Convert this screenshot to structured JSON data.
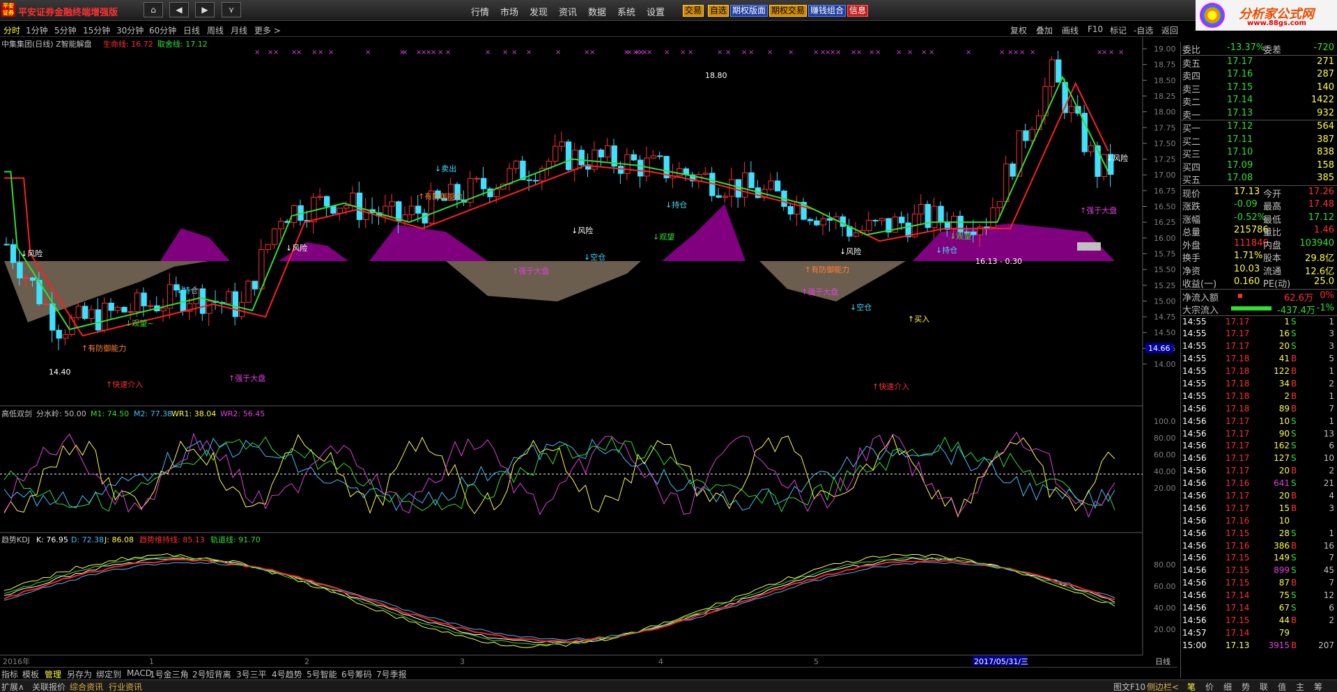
{
  "titlebar": {
    "logo_text": "平安证券",
    "app_title": "平安证券金融终端增强版",
    "menu": [
      "行情",
      "市场",
      "发现",
      "资讯",
      "数据",
      "系统",
      "设置"
    ],
    "buttons": [
      "交易",
      "自选",
      "期权版面",
      "期权交易",
      "赚钱组合",
      "信息"
    ]
  },
  "brand": {
    "name": "分析家公式网",
    "url": "www.88gs.com"
  },
  "periods": [
    "分时",
    "1分钟",
    "5分钟",
    "15分钟",
    "30分钟",
    "60分钟",
    "日线",
    "周线",
    "月线",
    "更多 >"
  ],
  "active_period": "分时",
  "right_tools": [
    "复权",
    "叠加",
    "画线",
    "F10",
    "标记",
    "-自选",
    "返回"
  ],
  "main": {
    "stock": "中集集团(日线) Z智能解盘",
    "line1_label": "生命线: 16.72",
    "line2_label": "取舍线: 17.12",
    "marker": "×",
    "price_tag": "14.66",
    "axis": [
      "19.00",
      "18.75",
      "18.50",
      "18.25",
      "18.00",
      "17.75",
      "17.50",
      "17.25",
      "17.00",
      "16.75",
      "16.50",
      "16.25",
      "16.00",
      "15.75",
      "15.50",
      "15.25",
      "15.00",
      "14.75",
      "14.50",
      "14.25",
      "14.00"
    ],
    "annotations": {
      "risk": "↓风险",
      "sell": "↓卖出",
      "buy": "↑买入",
      "strong": "↑强于大盘",
      "fast": "↑快速介入",
      "defense": "↑有防御能力",
      "wait": "↓观望~",
      "wait2": "↓观望",
      "hold": "↓持仓",
      "empty": "↓空仓",
      "high": "18.80",
      "low": "14.40",
      "range": "16.13 - 0.30"
    }
  },
  "osc": {
    "name": "高低双剑",
    "label": "分水岭: 50.00",
    "m1": "M1: 74.50",
    "m2": "M2: 77.38",
    "wr1": "WR1: 38.04",
    "wr2": "WR2: 56.45",
    "axis": [
      "100.0",
      "80.00",
      "60.00",
      "40.00",
      "20.00"
    ]
  },
  "kdj": {
    "name": "趋势KDJ",
    "k": "K: 76.95",
    "d": "D: 72.38",
    "j": "J: 86.08",
    "trend": "趋势维持线: 85.13",
    "track": "轨道线: 91.70",
    "axis": [
      "80.00",
      "60.00",
      "40.00",
      "20.00"
    ]
  },
  "xaxis": {
    "year": "2016年",
    "months": [
      "1",
      "2",
      "3",
      "4",
      "5"
    ],
    "date": "2017/05/31/三",
    "type": "日线"
  },
  "colors": {
    "up": "#ff3030",
    "down": "#40e0ff",
    "green": "#30e030",
    "red": "#ff2020",
    "purple": "#800080",
    "gray": "#6b5e4e"
  },
  "orderbook": {
    "wei": [
      {
        "label": "委比",
        "value": "-13.37%",
        "label2": "委差",
        "value2": "-720"
      }
    ],
    "sell": [
      {
        "l": "卖五",
        "p": "17.17",
        "v": "271"
      },
      {
        "l": "卖四",
        "p": "17.16",
        "v": "287"
      },
      {
        "l": "卖三",
        "p": "17.15",
        "v": "140"
      },
      {
        "l": "卖二",
        "p": "17.14",
        "v": "1422"
      },
      {
        "l": "卖一",
        "p": "17.13",
        "v": "932"
      }
    ],
    "buy": [
      {
        "l": "买一",
        "p": "17.12",
        "v": "564"
      },
      {
        "l": "买二",
        "p": "17.11",
        "v": "387"
      },
      {
        "l": "买三",
        "p": "17.10",
        "v": "838"
      },
      {
        "l": "买四",
        "p": "17.09",
        "v": "158"
      },
      {
        "l": "买五",
        "p": "17.08",
        "v": "385"
      }
    ],
    "stats": [
      {
        "l1": "现价",
        "v1": "17.13",
        "c1": "#ffff40",
        "l2": "今开",
        "v2": "17.26",
        "c2": "#ff3030"
      },
      {
        "l1": "涨跌",
        "v1": "-0.09",
        "c1": "#30e030",
        "l2": "最高",
        "v2": "17.48",
        "c2": "#ff3030"
      },
      {
        "l1": "涨幅",
        "v1": "-0.52%",
        "c1": "#30e030",
        "l2": "最低",
        "v2": "17.12",
        "c2": "#30e030"
      },
      {
        "l1": "总量",
        "v1": "215786",
        "c1": "#ffff40",
        "l2": "量比",
        "v2": "1.46",
        "c2": "#ff3030"
      },
      {
        "l1": "外盘",
        "v1": "111846",
        "c1": "#ff3030",
        "l2": "内盘",
        "v2": "103940",
        "c2": "#30e030"
      },
      {
        "l1": "换手",
        "v1": "1.71%",
        "c1": "#ffff40",
        "l2": "股本",
        "v2": "29.8亿",
        "c2": "#ffff40"
      },
      {
        "l1": "净资",
        "v1": "10.03",
        "c1": "#ffff40",
        "l2": "流通",
        "v2": "12.6亿",
        "c2": "#ffff40"
      },
      {
        "l1": "收益(一)",
        "v1": "0.160",
        "c1": "#ffff40",
        "l2": "PE(动)",
        "v2": "25.0",
        "c2": "#ffff40"
      }
    ],
    "netflow": {
      "l": "净流入额",
      "v": "62.6万",
      "p": "0%"
    },
    "bigflow": {
      "l": "大宗流入",
      "v": "-437.4万",
      "p": "-1%"
    }
  },
  "ticks": [
    [
      "14:55",
      "17.17",
      "1",
      "S",
      "1"
    ],
    [
      "14:55",
      "17.17",
      "16",
      "S",
      "3"
    ],
    [
      "14:55",
      "17.17",
      "20",
      "S",
      "3"
    ],
    [
      "14:55",
      "17.18",
      "41",
      "B",
      "5"
    ],
    [
      "14:55",
      "17.18",
      "122",
      "B",
      "1"
    ],
    [
      "14:55",
      "17.18",
      "34",
      "B",
      "2"
    ],
    [
      "14:55",
      "17.18",
      "2",
      "B",
      "1"
    ],
    [
      "14:56",
      "17.18",
      "89",
      "B",
      "7"
    ],
    [
      "14:56",
      "17.17",
      "10",
      "S",
      "1"
    ],
    [
      "14:56",
      "17.17",
      "90",
      "S",
      "13"
    ],
    [
      "14:56",
      "17.17",
      "162",
      "S",
      "6"
    ],
    [
      "14:56",
      "17.17",
      "127",
      "S",
      "10"
    ],
    [
      "14:56",
      "17.17",
      "20",
      "B",
      "2"
    ],
    [
      "14:56",
      "17.16",
      "641",
      "S",
      "21"
    ],
    [
      "14:56",
      "17.17",
      "20",
      "B",
      "4"
    ],
    [
      "14:56",
      "17.17",
      "15",
      "B",
      "3"
    ],
    [
      "14:56",
      "17.16",
      "10",
      "",
      ""
    ],
    [
      "14:56",
      "17.15",
      "28",
      "S",
      "1"
    ],
    [
      "14:56",
      "17.16",
      "386",
      "B",
      "16"
    ],
    [
      "14:56",
      "17.15",
      "149",
      "S",
      "7"
    ],
    [
      "14:56",
      "17.15",
      "899",
      "S",
      "45"
    ],
    [
      "14:56",
      "17.15",
      "87",
      "B",
      "7"
    ],
    [
      "14:56",
      "17.14",
      "75",
      "S",
      "12"
    ],
    [
      "14:56",
      "17.14",
      "67",
      "S",
      "6"
    ],
    [
      "14:56",
      "17.15",
      "44",
      "B",
      "2"
    ],
    [
      "14:57",
      "17.14",
      "79",
      "",
      ""
    ],
    [
      "15:00",
      "17.13",
      "3915",
      "B",
      "207"
    ]
  ],
  "bottom_tabs": [
    "指标",
    "模板",
    "管理",
    "另存为",
    "绑定到",
    "MACD",
    "1号金三角",
    "2号短背离",
    "3号三平",
    "4号趋势",
    "5号智能",
    "6号筹码",
    "7号季报"
  ],
  "status_tabs": [
    "扩展∧",
    "关联报价",
    "综合资讯",
    "行业资讯"
  ],
  "status_right": [
    "图文F10",
    "侧边栏<"
  ],
  "side_tabs": [
    "笔",
    "价",
    "细",
    "势",
    "联",
    "值",
    "主",
    "筹"
  ],
  "nav": {
    "home": "⌂",
    "back": "◀",
    "fwd": "▶",
    "more": "⋎"
  }
}
